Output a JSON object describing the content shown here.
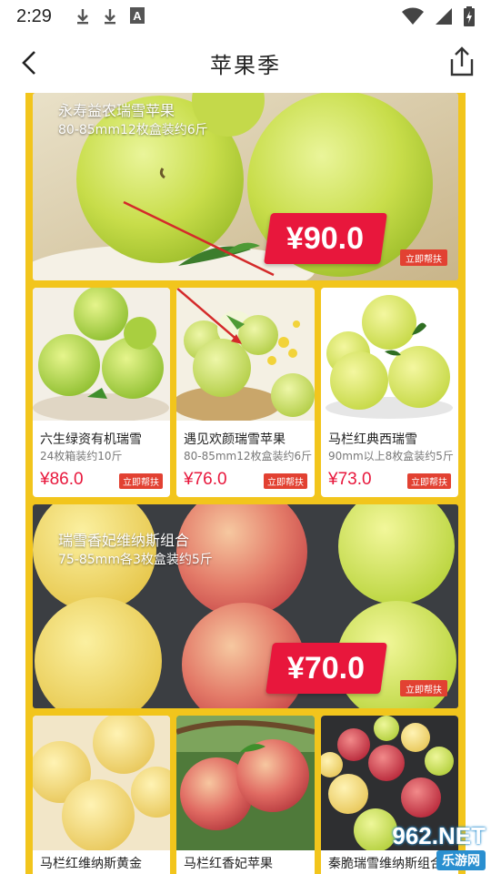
{
  "status_bar": {
    "time": "2:29",
    "icons": [
      "download-icon",
      "download-icon",
      "font-icon",
      "wifi-icon",
      "signal-icon",
      "battery-charging-icon"
    ]
  },
  "nav": {
    "title": "苹果季",
    "back_icon": "chevron-left-icon",
    "share_icon": "share-icon"
  },
  "colors": {
    "frame": "#f2c51c",
    "price_red": "#e8173c",
    "button_red": "#e24132"
  },
  "featured": [
    {
      "title": "永寿益农瑞雪苹果",
      "subtitle": "80-85mm12枚盒装约6斤",
      "price": "¥90.0",
      "button": "立即帮扶"
    },
    {
      "title": "瑞雪香妃维纳斯组合",
      "subtitle": "75-85mm各3枚盒装约5斤",
      "price": "¥70.0",
      "button": "立即帮扶"
    }
  ],
  "products_row1": [
    {
      "name": "六生绿资有机瑞雪",
      "spec": "24枚箱装约10斤",
      "price": "¥86.0",
      "button": "立即帮扶"
    },
    {
      "name": "遇见欢颜瑞雪苹果",
      "spec": "80-85mm12枚盒装约6斤",
      "price": "¥76.0",
      "button": "立即帮扶"
    },
    {
      "name": "马栏红典西瑞雪",
      "spec": "90mm以上8枚盒装约5斤",
      "price": "¥73.0",
      "button": "立即帮扶"
    }
  ],
  "products_row2": [
    {
      "name": "马栏红维纳斯黄金"
    },
    {
      "name": "马栏红香妃苹果"
    },
    {
      "name": "秦脆瑞雪维纳斯组合"
    }
  ],
  "watermark": {
    "logo": "962.NET",
    "caption": "乐游网"
  }
}
